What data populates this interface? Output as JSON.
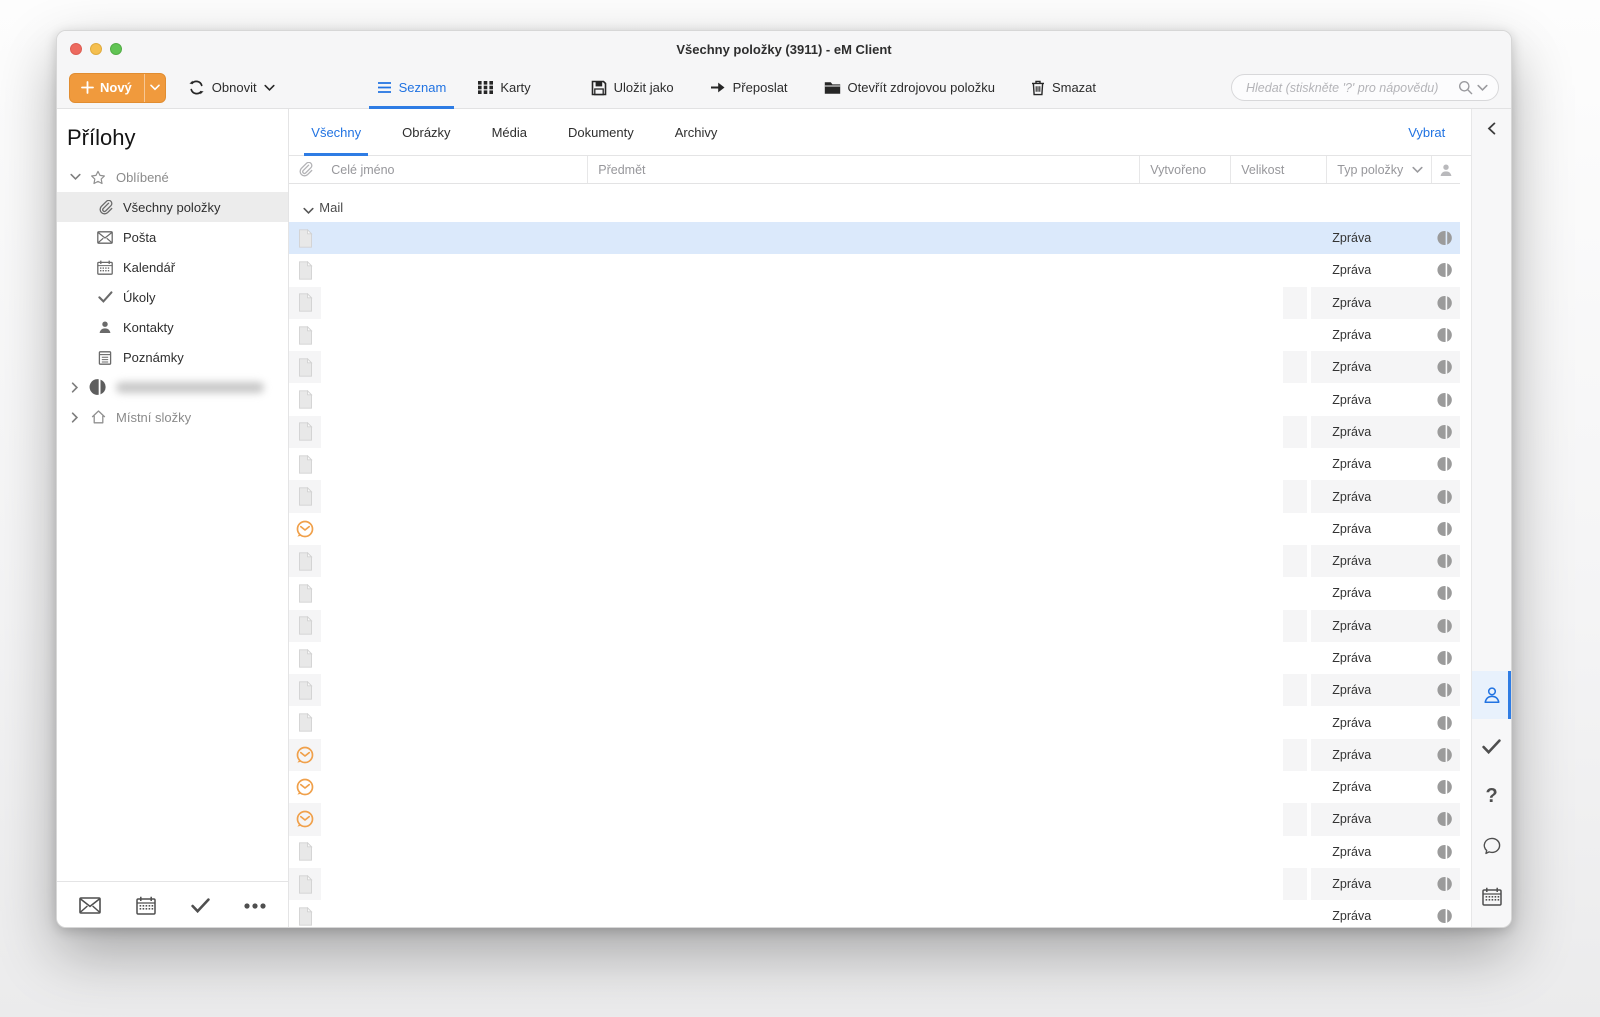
{
  "window": {
    "title": "Všechny položky (3911) - eM Client"
  },
  "toolbar": {
    "new_label": "Nový",
    "refresh_label": "Obnovit",
    "view_list_label": "Seznam",
    "view_cards_label": "Karty",
    "save_as_label": "Uložit jako",
    "forward_label": "Přeposlat",
    "open_source_label": "Otevřít zdrojovou položku",
    "delete_label": "Smazat",
    "search_placeholder": "Hledat (stiskněte '?' pro nápovědu)"
  },
  "sidebar": {
    "title": "Přílohy",
    "favorites_label": "Oblíbené",
    "favorites": [
      {
        "icon": "paperclip",
        "label": "Všechny položky",
        "selected": true
      },
      {
        "icon": "envelope",
        "label": "Pošta"
      },
      {
        "icon": "calendar",
        "label": "Kalendář"
      },
      {
        "icon": "check",
        "label": "Úkoly"
      },
      {
        "icon": "person",
        "label": "Kontakty"
      },
      {
        "icon": "notes",
        "label": "Poznámky"
      }
    ],
    "accounts": [
      {
        "icon": "avatar",
        "label": "",
        "redacted": true,
        "name": "account"
      },
      {
        "icon": "home",
        "label": "Místní složky",
        "redacted": false,
        "name": "local-folders"
      }
    ],
    "bottom_icons": [
      "mail",
      "calendar",
      "tasks",
      "more"
    ]
  },
  "tabs": {
    "items": [
      "Všechny",
      "Obrázky",
      "Média",
      "Dokumenty",
      "Archivy"
    ],
    "active_index": 0,
    "select_label": "Vybrat"
  },
  "table": {
    "columns": [
      "Celé jméno",
      "Předmět",
      "Vytvořeno",
      "Velikost",
      "Typ položky"
    ]
  },
  "list": {
    "group_label": "Mail",
    "type_label": "Zpráva",
    "rows": [
      {
        "icon": "document"
      },
      {
        "icon": "document"
      },
      {
        "icon": "document"
      },
      {
        "icon": "document"
      },
      {
        "icon": "document"
      },
      {
        "icon": "document"
      },
      {
        "icon": "document"
      },
      {
        "icon": "document"
      },
      {
        "icon": "document"
      },
      {
        "icon": "emclient"
      },
      {
        "icon": "document"
      },
      {
        "icon": "document"
      },
      {
        "icon": "document"
      },
      {
        "icon": "document"
      },
      {
        "icon": "document"
      },
      {
        "icon": "document"
      },
      {
        "icon": "emclient"
      },
      {
        "icon": "emclient"
      },
      {
        "icon": "emclient"
      },
      {
        "icon": "document"
      },
      {
        "icon": "document"
      },
      {
        "icon": "document"
      }
    ]
  },
  "right_panel": {
    "icons": [
      {
        "name": "contacts",
        "icon": "person-outline",
        "active": true
      },
      {
        "name": "tasks",
        "icon": "check-big",
        "active": false
      },
      {
        "name": "help",
        "icon": "question",
        "active": false
      },
      {
        "name": "chat",
        "icon": "bubble",
        "active": false
      },
      {
        "name": "calendar",
        "icon": "calendar-big",
        "active": false
      }
    ]
  },
  "colors": {
    "accent_blue": "#2173e2",
    "brand_orange": "#f09a3d",
    "selection_blue": "#dbe9fb",
    "stripe_gray": "#f5f5f6"
  }
}
